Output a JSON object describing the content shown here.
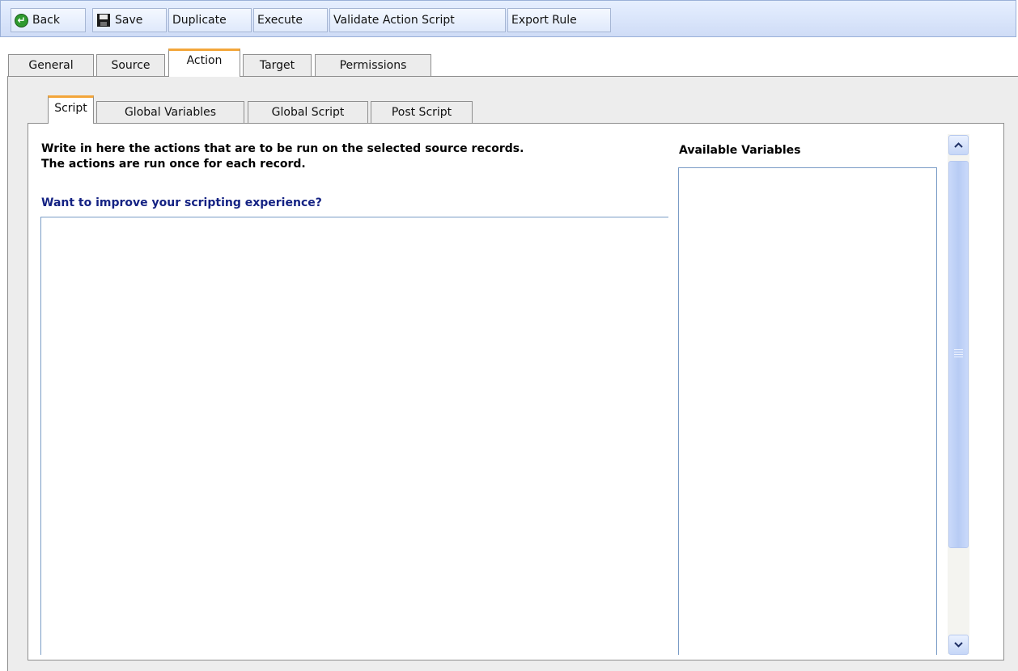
{
  "toolbar": {
    "back_label": "Back",
    "save_label": "Save",
    "duplicate_label": "Duplicate",
    "execute_label": "Execute",
    "validate_label": "Validate Action Script",
    "export_label": "Export Rule"
  },
  "main_tabs": [
    {
      "label": "General"
    },
    {
      "label": "Source"
    },
    {
      "label": "Action",
      "active": true
    },
    {
      "label": "Target"
    },
    {
      "label": "Permissions"
    }
  ],
  "sub_tabs": [
    {
      "label": "Script",
      "active": true
    },
    {
      "label": "Global Variables"
    },
    {
      "label": "Global Script"
    },
    {
      "label": "Post Script"
    }
  ],
  "script_panel": {
    "description_line1": "Write in here the actions that are to be run on the selected source records.",
    "description_line2": "The actions are run once for each record.",
    "improve_link": "Want to improve your scripting experience?",
    "script_value": ""
  },
  "variables_panel": {
    "title": "Available Variables",
    "items": []
  },
  "icons": {
    "back": "back-arrow-icon",
    "save": "floppy-disk-icon",
    "scroll_up": "chevron-up-icon",
    "scroll_down": "chevron-down-icon"
  },
  "colors": {
    "active_tab_accent": "#f3a63a",
    "link": "#142283",
    "toolbar_bg": "#d8e4fa",
    "back_icon": "#2f9a2f"
  }
}
